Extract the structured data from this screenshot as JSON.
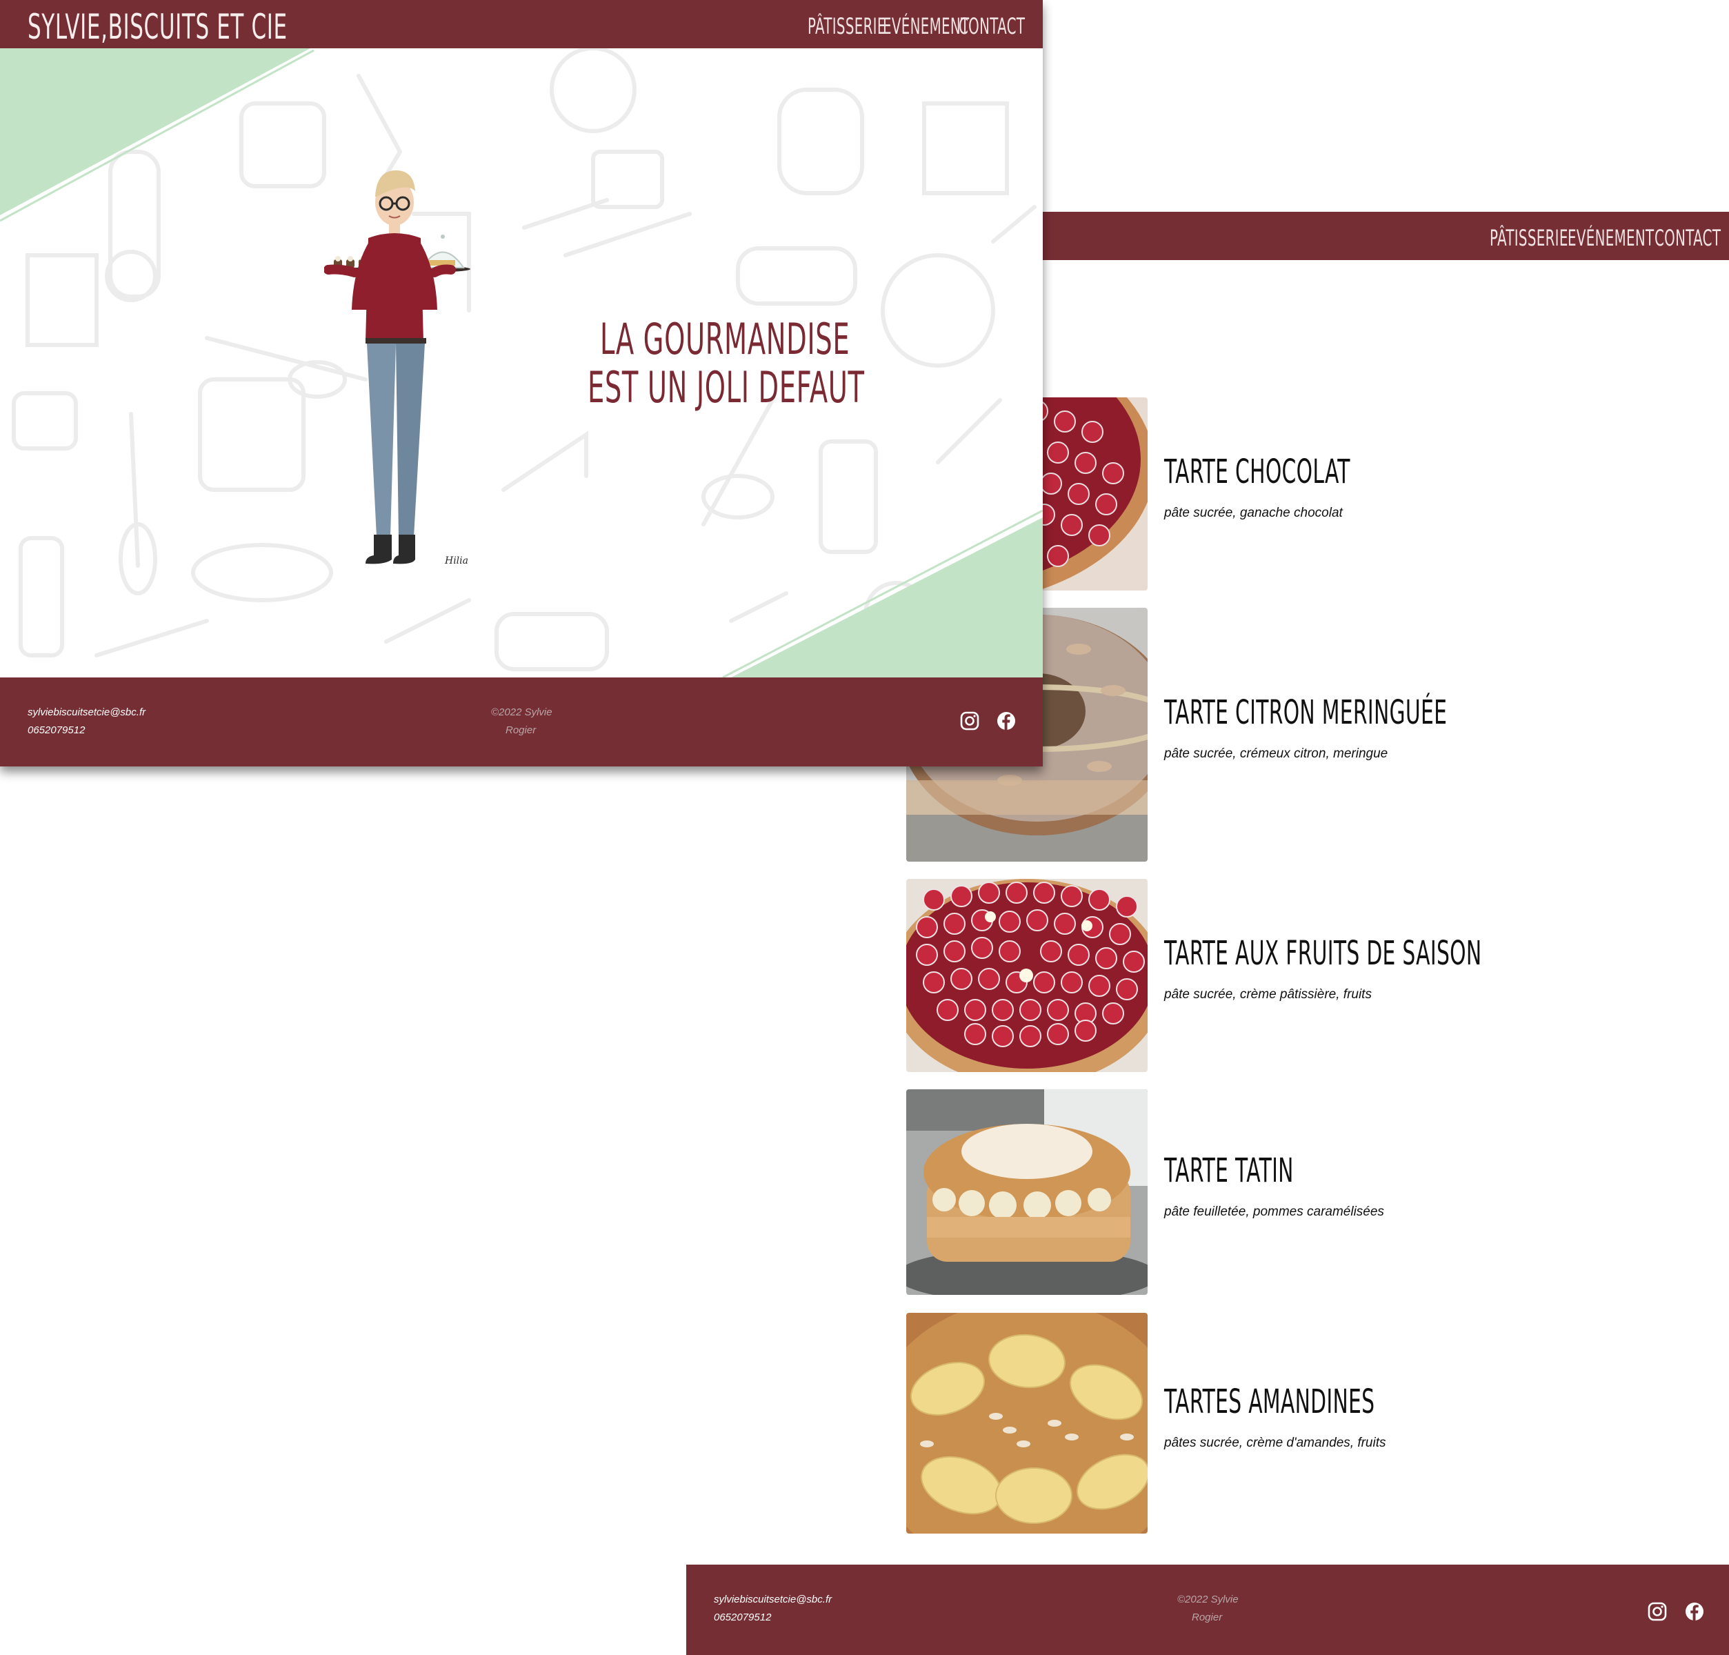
{
  "colors": {
    "brand": "#762e35",
    "accent_green": "#c3e3c7",
    "tagline": "#7a2a33"
  },
  "front": {
    "brand": "SYLVIE,BISCUITS ET CIE",
    "nav": [
      "PÂTISSERIE",
      "EVÉNEMENT",
      "CONTACT"
    ],
    "tagline_line1": "LA GOURMANDISE",
    "tagline_line2": "EST UN JOLI DEFAUT",
    "footer": {
      "email": "sylviebiscuitsetcie@sbc.fr",
      "phone": "0652079512",
      "copyright_line1": "©2022 Sylvie",
      "copyright_line2": "Rogier",
      "social_icons": [
        "instagram-icon",
        "facebook-icon"
      ]
    }
  },
  "back": {
    "nav": [
      "PÂTISSERIE",
      "EVÉNEMENT",
      "CONTACT"
    ],
    "pastries": [
      {
        "title": "TARTE CHOCOLAT",
        "description": "pâte sucrée, ganache chocolat"
      },
      {
        "title": "TARTE CITRON MERINGUÉE",
        "description": "pâte sucrée, crémeux citron, meringue"
      },
      {
        "title": "TARTE AUX FRUITS DE SAISON",
        "description": "pâte sucrée, crème pâtissière, fruits"
      },
      {
        "title": "TARTE TATIN",
        "description": "pâte feuilletée, pommes caramélisées"
      },
      {
        "title": "TARTES AMANDINES",
        "description": "pâtes sucrée, crème d'amandes, fruits"
      }
    ],
    "footer": {
      "email": "sylviebiscuitsetcie@sbc.fr",
      "phone": "0652079512",
      "copyright_line1": "©2022 Sylvie",
      "copyright_line2": "Rogier",
      "social_icons": [
        "instagram-icon",
        "facebook-icon"
      ]
    }
  }
}
